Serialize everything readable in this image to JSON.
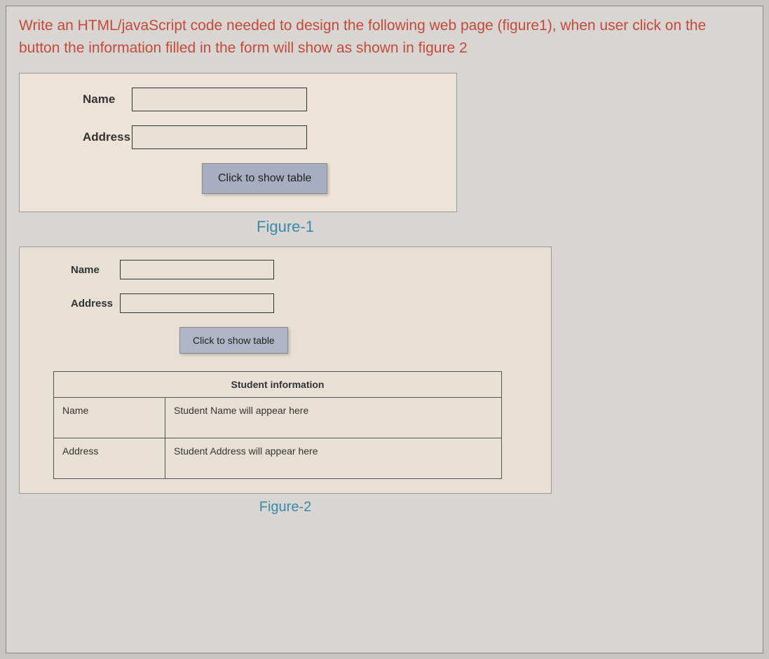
{
  "question": "Write an HTML/javaScript code needed to design the following web page (figure1), when user click on the button the information filled in the form will show as shown in figure 2",
  "figure1": {
    "name_label": "Name",
    "address_label": "Address",
    "button_label": "Click to show table",
    "caption": "Figure-1"
  },
  "figure2": {
    "name_label": "Name",
    "address_label": "Address",
    "button_label": "Click to show table",
    "table": {
      "header": "Student information",
      "row1_label": "Name",
      "row1_value": "Student Name will appear here",
      "row2_label": "Address",
      "row2_value": "Student Address will appear here"
    },
    "caption": "Figure-2"
  }
}
